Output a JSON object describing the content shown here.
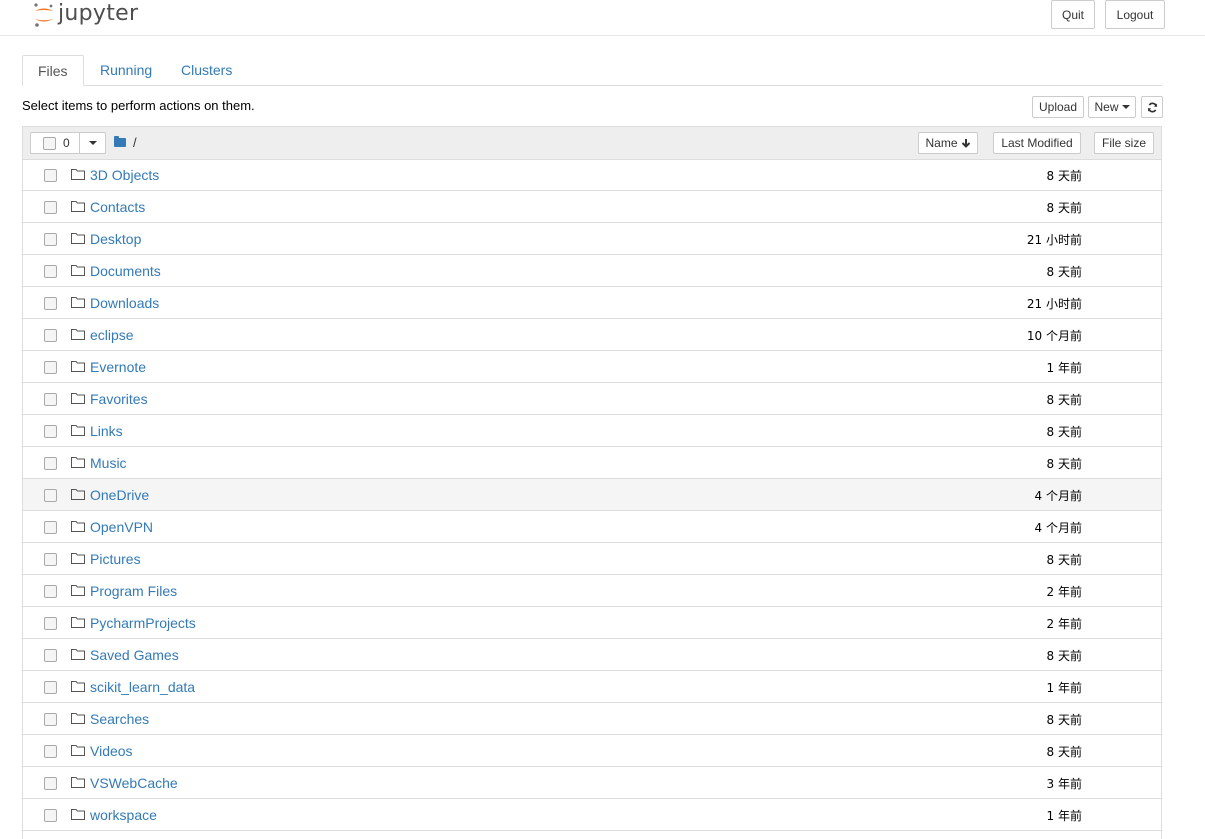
{
  "header": {
    "logo_text": "jupyter",
    "quit_label": "Quit",
    "logout_label": "Logout"
  },
  "tabs": [
    {
      "label": "Files",
      "active": true
    },
    {
      "label": "Running",
      "active": false
    },
    {
      "label": "Clusters",
      "active": false
    }
  ],
  "toolbar": {
    "hint": "Select items to perform actions on them.",
    "upload_label": "Upload",
    "new_label": "New",
    "refresh_icon": "refresh-icon"
  },
  "list_header": {
    "selected_count": "0",
    "breadcrumb": "/",
    "name_label": "Name",
    "last_modified_label": "Last Modified",
    "file_size_label": "File size"
  },
  "files": [
    {
      "name": "3D Objects",
      "modified": "8 天前"
    },
    {
      "name": "Contacts",
      "modified": "8 天前"
    },
    {
      "name": "Desktop",
      "modified": "21 小时前"
    },
    {
      "name": "Documents",
      "modified": "8 天前"
    },
    {
      "name": "Downloads",
      "modified": "21 小时前"
    },
    {
      "name": "eclipse",
      "modified": "10 个月前"
    },
    {
      "name": "Evernote",
      "modified": "1 年前"
    },
    {
      "name": "Favorites",
      "modified": "8 天前"
    },
    {
      "name": "Links",
      "modified": "8 天前"
    },
    {
      "name": "Music",
      "modified": "8 天前"
    },
    {
      "name": "OneDrive",
      "modified": "4 个月前",
      "highlighted": true
    },
    {
      "name": "OpenVPN",
      "modified": "4 个月前"
    },
    {
      "name": "Pictures",
      "modified": "8 天前"
    },
    {
      "name": "Program Files",
      "modified": "2 年前"
    },
    {
      "name": "PycharmProjects",
      "modified": "2 年前"
    },
    {
      "name": "Saved Games",
      "modified": "8 天前"
    },
    {
      "name": "scikit_learn_data",
      "modified": "1 年前"
    },
    {
      "name": "Searches",
      "modified": "8 天前"
    },
    {
      "name": "Videos",
      "modified": "8 天前"
    },
    {
      "name": "VSWebCache",
      "modified": "3 年前"
    },
    {
      "name": "workspace",
      "modified": "1 年前"
    }
  ],
  "colors": {
    "link": "#337ab7",
    "logo_orange": "#f37726",
    "header_bg": "#eeeeee",
    "row_highlight": "#f5f5f5"
  }
}
